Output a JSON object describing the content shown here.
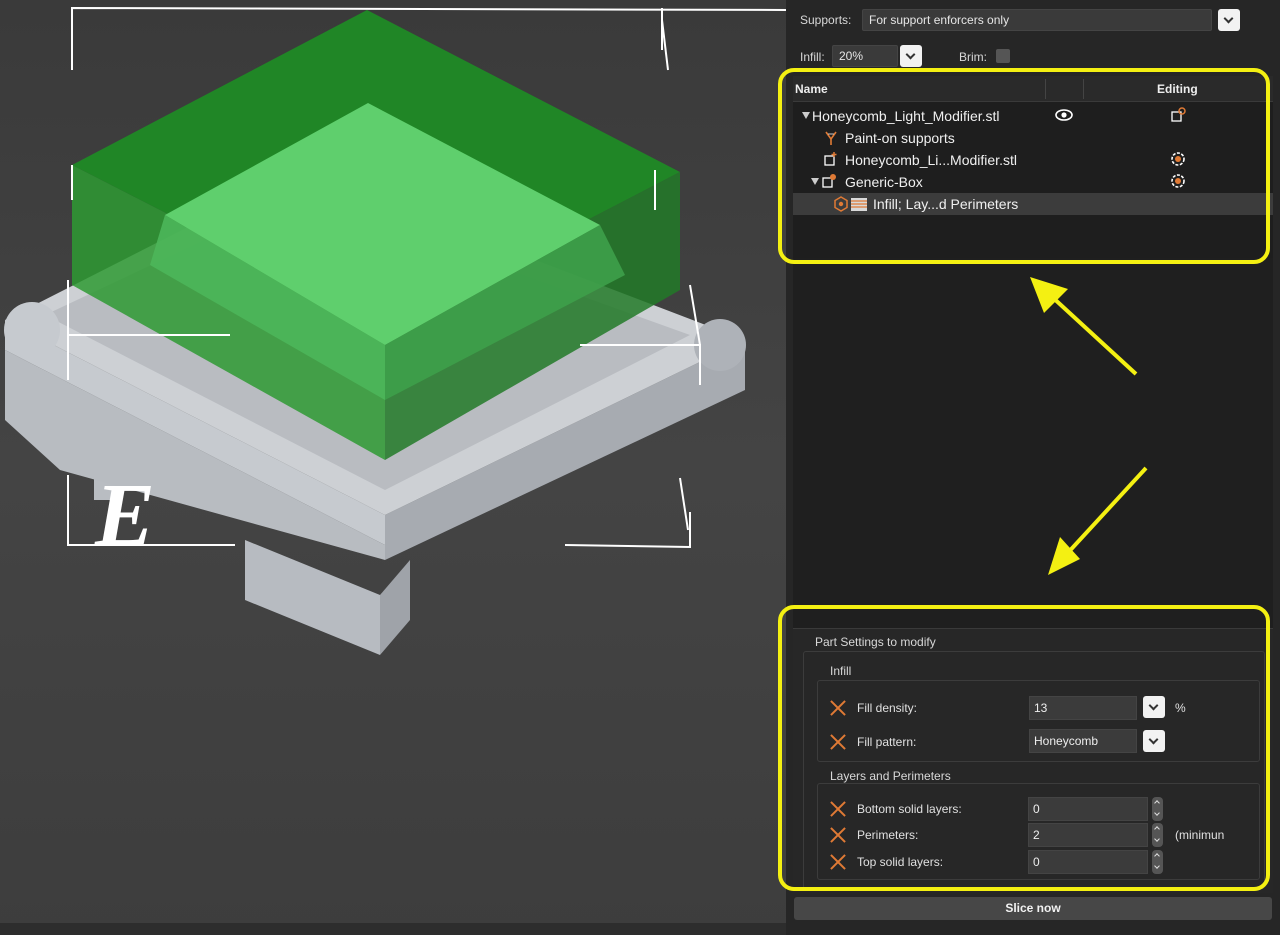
{
  "sidebar": {
    "supports_label": "Supports:",
    "supports_value": "For support enforcers only",
    "infill_label": "Infill:",
    "infill_value": "20%",
    "brim_label": "Brim:"
  },
  "object_list": {
    "col_name": "Name",
    "col_editing": "Editing",
    "rows": [
      {
        "label": "Honeycomb_Light_Modifier.stl",
        "icon": "eye-icon",
        "edit_icon": "edit-part-icon"
      },
      {
        "label": "Paint-on supports",
        "icon": "paint-supports-icon"
      },
      {
        "label": "Honeycomb_Li...Modifier.stl",
        "icon": "part-icon",
        "edit_icon": "settings-gear-icon"
      },
      {
        "label": "Generic-Box",
        "icon": "modifier-icon",
        "edit_icon": "settings-gear-icon"
      },
      {
        "label": "Infill; Lay...d Perimeters",
        "icon": "settings-stack-icon"
      }
    ]
  },
  "part_settings": {
    "title": "Part Settings to modify",
    "infill_group": "Infill",
    "fill_density_label": "Fill density:",
    "fill_density_value": "13",
    "fill_density_unit": "%",
    "fill_pattern_label": "Fill pattern:",
    "fill_pattern_value": "Honeycomb",
    "layers_group": "Layers and Perimeters",
    "bottom_solid_label": "Bottom solid layers:",
    "bottom_solid_value": "0",
    "perimeters_label": "Perimeters:",
    "perimeters_value": "2",
    "perimeters_note": "(minimun",
    "top_solid_label": "Top solid layers:",
    "top_solid_value": "0"
  },
  "slice_button": "Slice now",
  "colors": {
    "highlight": "#f4f012",
    "modifier_green": "#4cc05a",
    "accent_orange": "#e07a35"
  }
}
